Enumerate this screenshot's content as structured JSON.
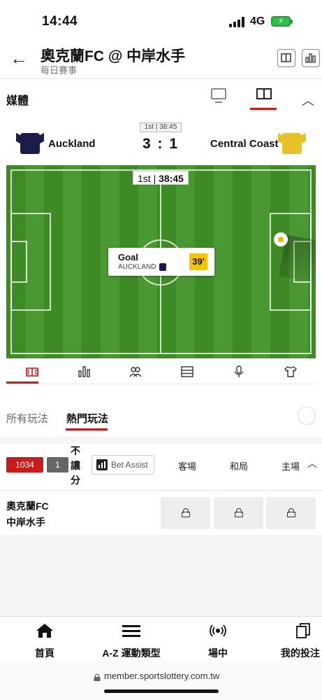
{
  "status_bar": {
    "time": "14:44",
    "network": "4G"
  },
  "header": {
    "title": "奧克蘭FC @ 中岸水手",
    "subtitle": "每日賽事"
  },
  "media": {
    "label": "媒體"
  },
  "match": {
    "period": "1st | 38:45",
    "home_team": "Auckland",
    "away_team": "Central Coast",
    "score": "3 : 1",
    "home_shirt_color": "#1c1c4a",
    "away_shirt_color": "#e5c229"
  },
  "pitch": {
    "clock_period": "1st",
    "clock_time": "38:45",
    "event": {
      "title": "Goal",
      "team": "AUCKLAND",
      "minute": "39'"
    }
  },
  "stat_tabs": {
    "icons": [
      "pitch-icon",
      "stats-icon",
      "lineup-icon",
      "table-icon",
      "commentary-icon",
      "shirt-icon"
    ]
  },
  "bet_tabs": {
    "all": "所有玩法",
    "popular": "熱門玩法"
  },
  "market": {
    "count": "1034",
    "sub_count": "1",
    "name": "不讓分",
    "bet_assist": "Bet Assist",
    "columns": [
      "客場",
      "和局",
      "主場"
    ]
  },
  "rows": [
    {
      "home": "奧克蘭FC",
      "away": "中岸水手"
    }
  ],
  "bottom_nav": {
    "home": "首頁",
    "sports": "A-Z 運動類型",
    "live": "場中",
    "bets": "我的投注"
  },
  "url": "member.sportslottery.com.tw",
  "colors": {
    "accent": "#c81b1b",
    "pitch": "#3e8a27",
    "highlight": "#f5c400"
  }
}
